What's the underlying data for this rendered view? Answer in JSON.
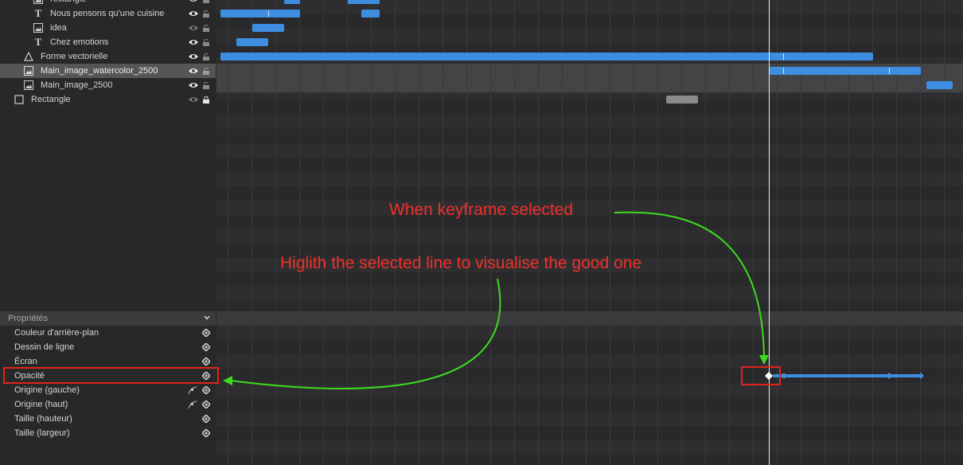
{
  "layers": [
    {
      "label": "rectangle",
      "icon": "image-icon"
    },
    {
      "label": "Nous pensons qu'une cuisine",
      "icon": "text-icon"
    },
    {
      "label": "idea",
      "icon": "image-icon"
    },
    {
      "label": "Chez emotions",
      "icon": "text-icon"
    },
    {
      "label": "Forme vectorielle",
      "icon": "vector-shape-icon"
    },
    {
      "label": "Main_image_watercolor_2500",
      "icon": "image-icon",
      "selected": true
    },
    {
      "label": "Main_image_2500",
      "icon": "image-icon"
    },
    {
      "label": "Rectangle",
      "icon": "rectangle-icon"
    }
  ],
  "properties_panel": {
    "title": "Propriétés",
    "items": [
      {
        "label": "Couleur d'arrière-plan"
      },
      {
        "label": "Dessin de ligne"
      },
      {
        "label": "Écran"
      },
      {
        "label": "Opacité",
        "highlighted": true
      },
      {
        "label": "Origine (gauche)",
        "path_icon": true
      },
      {
        "label": "Origine (haut)",
        "path_icon": true
      },
      {
        "label": "Taille (hauteur)"
      },
      {
        "label": "Taille (largeur)"
      }
    ]
  },
  "annotations": {
    "keyframe_note": "When keyframe selected",
    "highlight_note": "Higlith the selected line to visualise the good one"
  },
  "colors": {
    "clip": "#3d8ee0",
    "clip_disabled": "#8a8a8a",
    "annotation_text": "#f0302a",
    "annotation_box": "#e2231a",
    "annotation_arrow": "#3ddc1e",
    "playhead": "#f2f2f2"
  }
}
